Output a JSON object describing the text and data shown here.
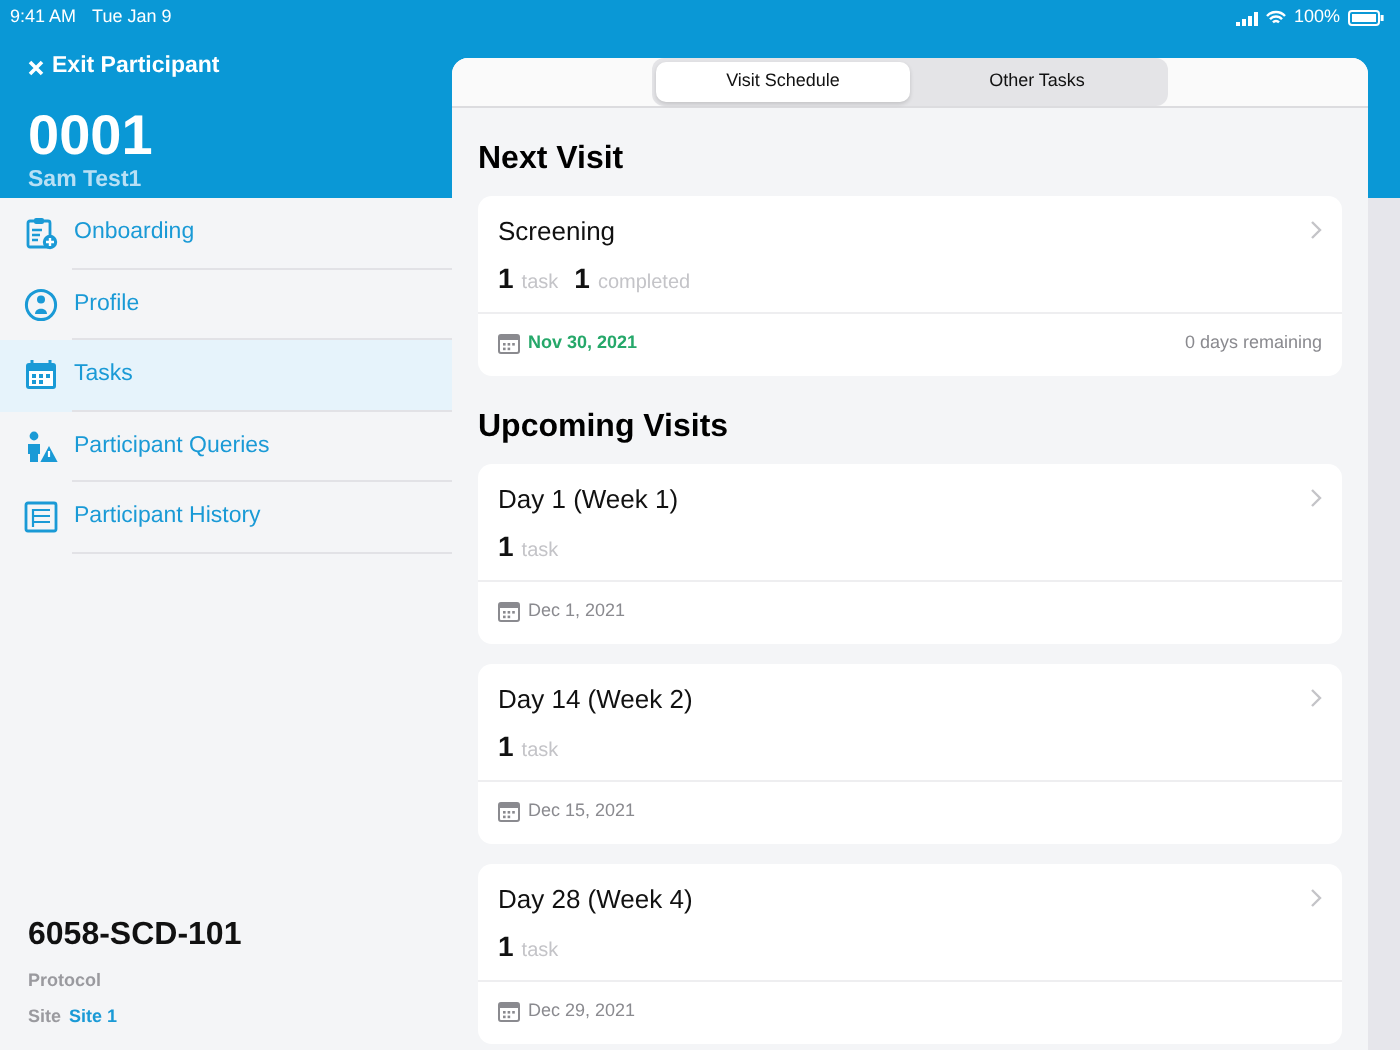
{
  "status_bar": {
    "time": "9:41 AM",
    "date": "Tue Jan 9",
    "battery": "100%"
  },
  "header": {
    "exit_label": "Exit Participant",
    "participant_id": "0001",
    "participant_name": "Sam Test1"
  },
  "sidebar": {
    "items": [
      {
        "label": "Onboarding",
        "kind": "onboarding",
        "selected": false
      },
      {
        "label": "Profile",
        "kind": "profile",
        "selected": false
      },
      {
        "label": "Tasks",
        "kind": "tasks",
        "selected": true
      },
      {
        "label": "Participant Queries",
        "kind": "queries",
        "selected": false
      },
      {
        "label": "Participant History",
        "kind": "history",
        "selected": false
      }
    ]
  },
  "protocol": {
    "code": "6058-SCD-101",
    "label": "Protocol",
    "site_label": "Site",
    "site": "Site 1"
  },
  "segments": [
    {
      "label": "Visit Schedule",
      "selected": true
    },
    {
      "label": "Other Tasks",
      "selected": false
    }
  ],
  "sections": [
    {
      "heading": "Next Visit",
      "visits": [
        {
          "title": "Screening",
          "counts": [
            {
              "number": "1",
              "unit": "task"
            },
            {
              "number": "1",
              "unit": "completed"
            }
          ],
          "date": "Nov 30, 2021",
          "highlighted": true,
          "remaining": "0 days remaining"
        }
      ]
    },
    {
      "heading": "Upcoming Visits",
      "visits": [
        {
          "title": "Day 1 (Week 1)",
          "counts": [
            {
              "number": "1",
              "unit": "task"
            }
          ],
          "date": "Dec 1, 2021",
          "highlighted": false
        },
        {
          "title": "Day 14 (Week 2)",
          "counts": [
            {
              "number": "1",
              "unit": "task"
            }
          ],
          "date": "Dec 15, 2021",
          "highlighted": false
        },
        {
          "title": "Day 28 (Week 4)",
          "counts": [
            {
              "number": "1",
              "unit": "task"
            }
          ],
          "date": "Dec 29, 2021",
          "highlighted": false
        }
      ]
    }
  ]
}
